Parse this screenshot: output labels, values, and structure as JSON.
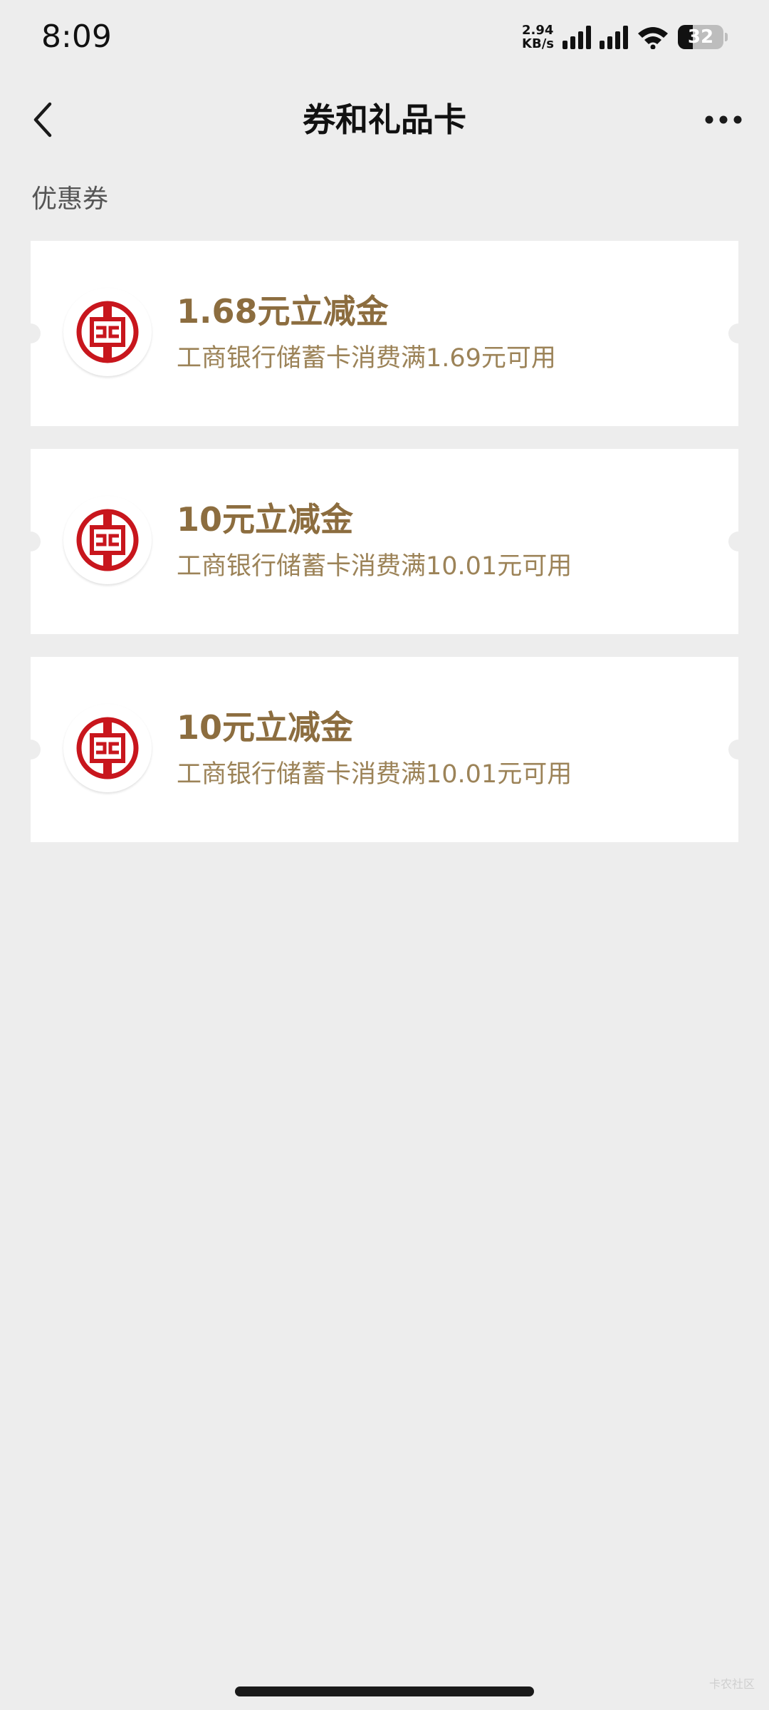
{
  "status_bar": {
    "time": "8:09",
    "net_speed_value": "2.94",
    "net_speed_unit": "KB/s",
    "battery": "32"
  },
  "nav": {
    "title": "券和礼品卡",
    "back_icon": "chevron-left-icon",
    "more_icon": "more-horizontal-icon"
  },
  "section": {
    "label": "优惠券"
  },
  "coupons": [
    {
      "amount": "1.68元立减金",
      "condition": "工商银行储蓄卡消费满1.69元可用"
    },
    {
      "amount": "10元立减金",
      "condition": "工商银行储蓄卡消费满10.01元可用"
    },
    {
      "amount": "10元立减金",
      "condition": "工商银行储蓄卡消费满10.01元可用"
    }
  ],
  "colors": {
    "background": "#ededed",
    "card": "#ffffff",
    "amount_text": "#8c6d3f",
    "condition_text": "#9c8358",
    "bank_logo_red": "#c8161d"
  },
  "watermark": "卡农社区"
}
